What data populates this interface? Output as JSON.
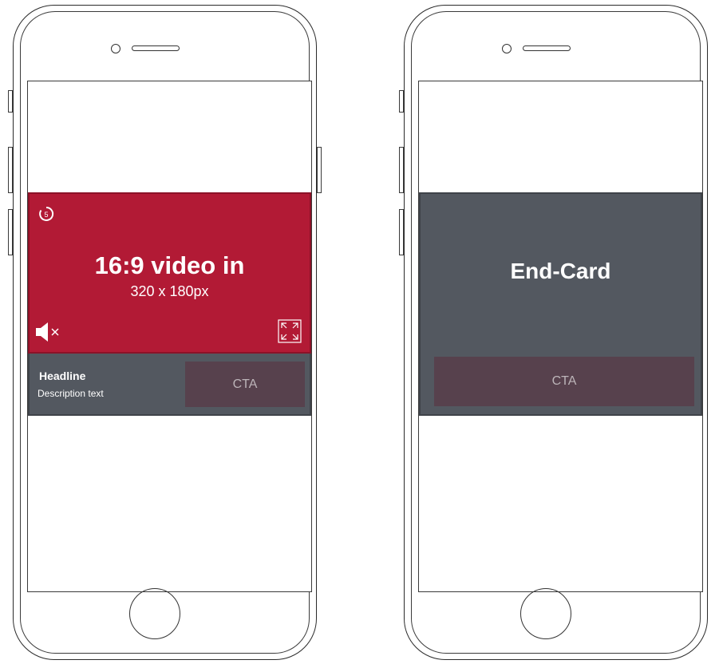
{
  "video_ad": {
    "title": "16:9 video in",
    "subtitle": "320 x 180px",
    "countdown": "5",
    "headline": "Headline",
    "description": "Description text",
    "cta_label": "CTA"
  },
  "end_card": {
    "title": "End-Card",
    "cta_label": "CTA"
  },
  "colors": {
    "video_red": "#b21a35",
    "panel_gray": "#535860",
    "cta_mauve": "#57414d",
    "cta_text": "#bcb4b8"
  },
  "icons": [
    "timer-icon",
    "mute-icon",
    "fullscreen-icon",
    "camera-icon",
    "speaker-icon",
    "home-button-icon"
  ]
}
